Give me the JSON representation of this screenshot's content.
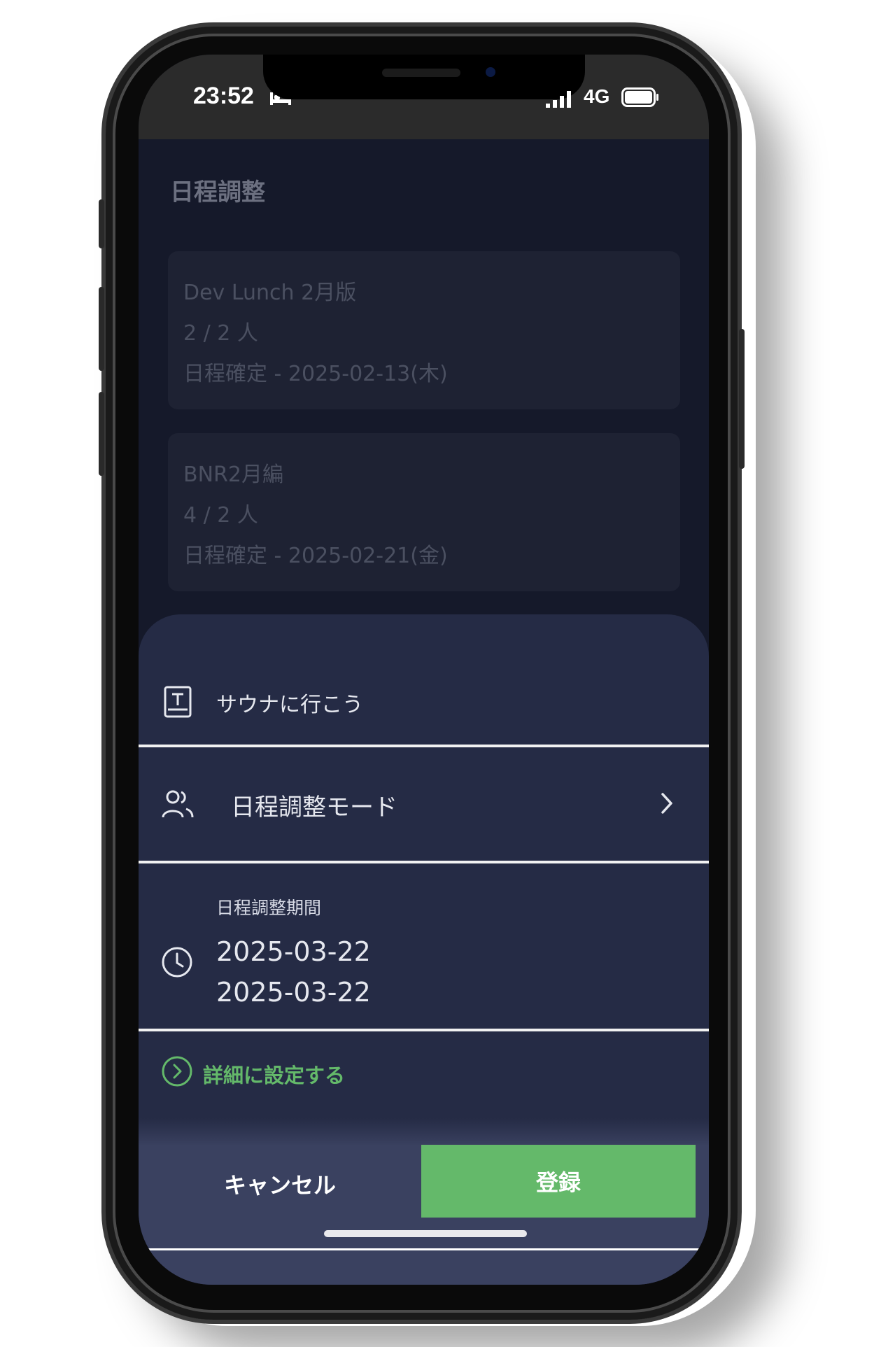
{
  "status_bar": {
    "time": "23:52",
    "network": "4G",
    "icons": [
      "bed-icon",
      "signal-icon",
      "battery-icon"
    ]
  },
  "page": {
    "title": "日程調整"
  },
  "cards": [
    {
      "title": "Dev Lunch 2月版",
      "count": "2 / 2 人",
      "status": "日程確定 - 2025-02-13(木)"
    },
    {
      "title": "BNR2月編",
      "count": "4 / 2 人",
      "status": "日程確定 - 2025-02-21(金)"
    }
  ],
  "sheet": {
    "title_value": "サウナに行こう",
    "mode_label": "日程調整モード",
    "period_label": "日程調整期間",
    "period_start": "2025-03-22",
    "period_end": "2025-03-22",
    "details_link": "詳細に設定する",
    "cancel_label": "キャンセル",
    "register_label": "登録"
  },
  "colors": {
    "accent_green": "#64b96a",
    "sheet_bg": "#252b45",
    "page_bg": "#15192a"
  }
}
